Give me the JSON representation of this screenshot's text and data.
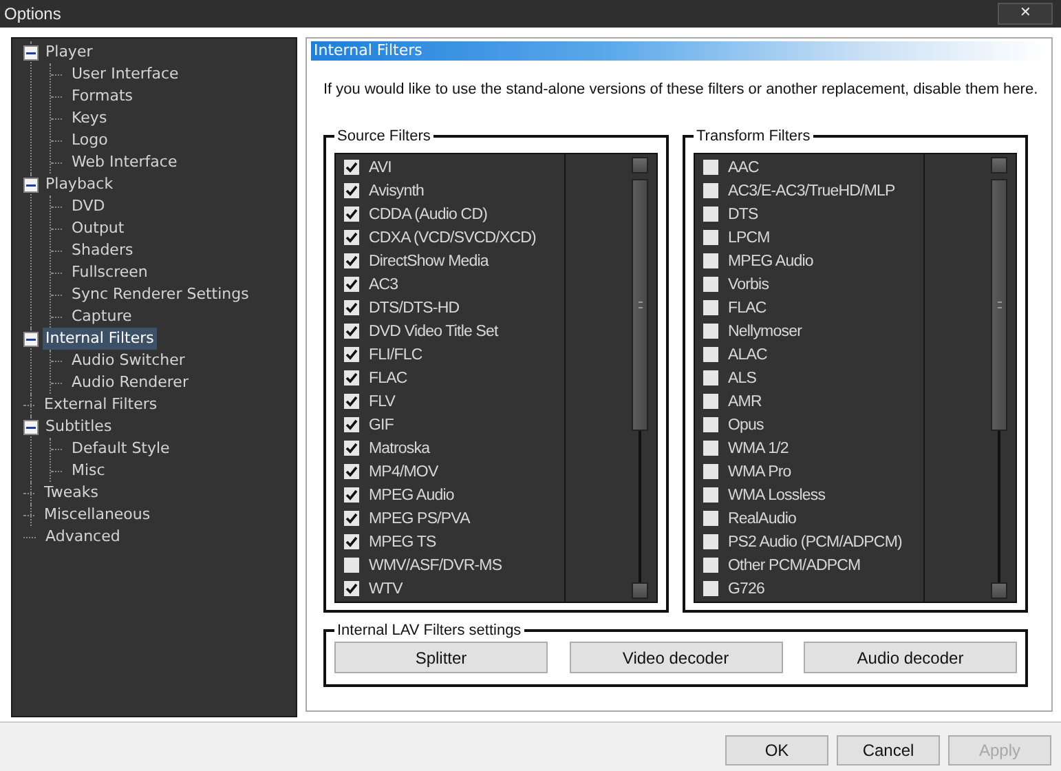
{
  "window": {
    "title": "Options",
    "close_label": "✕"
  },
  "tree": [
    {
      "label": "Player",
      "expanded": true,
      "selected": false,
      "children": [
        {
          "label": "User Interface",
          "selected": false
        },
        {
          "label": "Formats",
          "selected": false
        },
        {
          "label": "Keys",
          "selected": false
        },
        {
          "label": "Logo",
          "selected": false
        },
        {
          "label": "Web Interface",
          "selected": false
        }
      ]
    },
    {
      "label": "Playback",
      "expanded": true,
      "selected": false,
      "children": [
        {
          "label": "DVD",
          "selected": false
        },
        {
          "label": "Output",
          "selected": false
        },
        {
          "label": "Shaders",
          "selected": false
        },
        {
          "label": "Fullscreen",
          "selected": false
        },
        {
          "label": "Sync Renderer Settings",
          "selected": false
        },
        {
          "label": "Capture",
          "selected": false
        }
      ]
    },
    {
      "label": "Internal Filters",
      "expanded": true,
      "selected": true,
      "children": [
        {
          "label": "Audio Switcher",
          "selected": false
        },
        {
          "label": "Audio Renderer",
          "selected": false
        }
      ]
    },
    {
      "label": "External Filters",
      "selected": false
    },
    {
      "label": "Subtitles",
      "expanded": true,
      "selected": false,
      "children": [
        {
          "label": "Default Style",
          "selected": false
        },
        {
          "label": "Misc",
          "selected": false
        }
      ]
    },
    {
      "label": "Tweaks",
      "selected": false
    },
    {
      "label": "Miscellaneous",
      "selected": false
    },
    {
      "label": "Advanced",
      "selected": false
    }
  ],
  "page": {
    "header": "Internal Filters",
    "description": "If you would like to use the stand-alone versions of these filters or another replacement, disable them here."
  },
  "filter_groups": [
    {
      "title": "Source Filters",
      "items": [
        {
          "label": "AVI",
          "checked": true
        },
        {
          "label": "Avisynth",
          "checked": true
        },
        {
          "label": "CDDA (Audio CD)",
          "checked": true
        },
        {
          "label": "CDXA (VCD/SVCD/XCD)",
          "checked": true
        },
        {
          "label": "DirectShow Media",
          "checked": true
        },
        {
          "label": "AC3",
          "checked": true
        },
        {
          "label": "DTS/DTS-HD",
          "checked": true
        },
        {
          "label": "DVD Video Title Set",
          "checked": true
        },
        {
          "label": "FLI/FLC",
          "checked": true
        },
        {
          "label": "FLAC",
          "checked": true
        },
        {
          "label": "FLV",
          "checked": true
        },
        {
          "label": "GIF",
          "checked": true
        },
        {
          "label": "Matroska",
          "checked": true
        },
        {
          "label": "MP4/MOV",
          "checked": true
        },
        {
          "label": "MPEG Audio",
          "checked": true
        },
        {
          "label": "MPEG PS/PVA",
          "checked": true
        },
        {
          "label": "MPEG TS",
          "checked": true
        },
        {
          "label": "WMV/ASF/DVR-MS",
          "checked": false
        },
        {
          "label": "WTV",
          "checked": true
        }
      ]
    },
    {
      "title": "Transform Filters",
      "items": [
        {
          "label": "AAC",
          "checked": false
        },
        {
          "label": "AC3/E-AC3/TrueHD/MLP",
          "checked": false
        },
        {
          "label": "DTS",
          "checked": false
        },
        {
          "label": "LPCM",
          "checked": false
        },
        {
          "label": "MPEG Audio",
          "checked": false
        },
        {
          "label": "Vorbis",
          "checked": false
        },
        {
          "label": "FLAC",
          "checked": false
        },
        {
          "label": "Nellymoser",
          "checked": false
        },
        {
          "label": "ALAC",
          "checked": false
        },
        {
          "label": "ALS",
          "checked": false
        },
        {
          "label": "AMR",
          "checked": false
        },
        {
          "label": "Opus",
          "checked": false
        },
        {
          "label": "WMA 1/2",
          "checked": false
        },
        {
          "label": "WMA Pro",
          "checked": false
        },
        {
          "label": "WMA Lossless",
          "checked": false
        },
        {
          "label": "RealAudio",
          "checked": false
        },
        {
          "label": "PS2 Audio (PCM/ADPCM)",
          "checked": false
        },
        {
          "label": "Other PCM/ADPCM",
          "checked": false
        },
        {
          "label": "G726",
          "checked": false
        }
      ]
    }
  ],
  "lav_settings": {
    "title": "Internal LAV Filters settings",
    "buttons": [
      "Splitter",
      "Video decoder",
      "Audio decoder"
    ]
  },
  "dialog_buttons": [
    {
      "label": "OK",
      "disabled": false
    },
    {
      "label": "Cancel",
      "disabled": false
    },
    {
      "label": "Apply",
      "disabled": true
    }
  ]
}
